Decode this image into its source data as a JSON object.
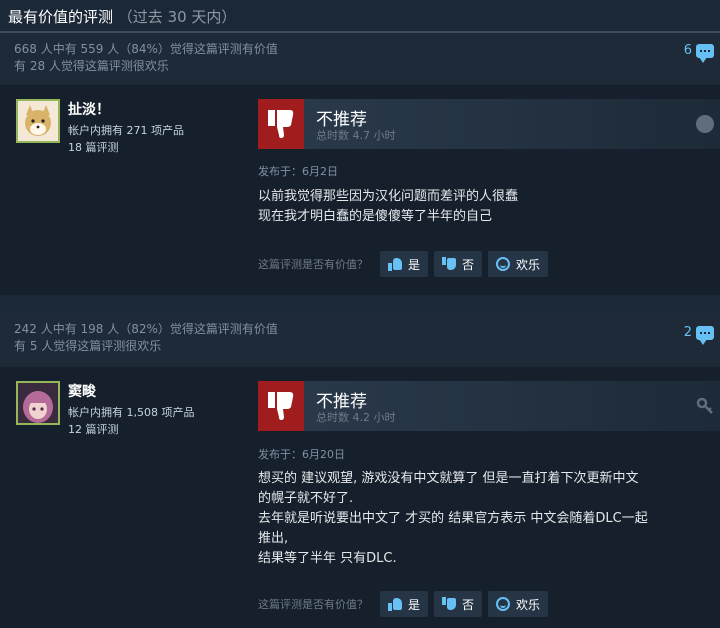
{
  "section": {
    "title": "最有价值的评测",
    "subtitle": "（过去 30 天内）"
  },
  "feedback_labels": {
    "question": "这篇评测是否有价值？",
    "yes": "是",
    "no": "否",
    "funny": "欢乐"
  },
  "reviews": [
    {
      "helpful": "668 人中有 559 人（84%）觉得这篇评测有价值",
      "funny": "有 28 人觉得这篇评测很欢乐",
      "comment_count": "6",
      "author_name": "扯淡！",
      "products": "帐户内拥有 271 项产品",
      "review_count": "18 篇评测",
      "verdict": "不推荐",
      "hours": "总时数 4.7 小时",
      "posted": "发布于：6月2日",
      "body": [
        "以前我觉得那些因为汉化问题而差评的人很蠢",
        "现在我才明白蠢的是傻傻等了半年的自己"
      ],
      "platform_icon": "steam-icon",
      "avatar_color": "#d9b36a"
    },
    {
      "helpful": "242 人中有 198 人（82%）觉得这篇评测有价值",
      "funny": "有 5 人觉得这篇评测很欢乐",
      "comment_count": "2",
      "author_name": "窦畯",
      "products": "帐户内拥有 1,508 项产品",
      "review_count": "12 篇评测",
      "verdict": "不推荐",
      "hours": "总时数 4.2 小时",
      "posted": "发布于：6月20日",
      "body": [
        "想买的 建议观望, 游戏没有中文就算了 但是一直打着下次更新中文",
        "的幌子就不好了.",
        "去年就是听说要出中文了 才买的 结果官方表示 中文会随着DLC一起",
        "推出,",
        "结果等了半年 只有DLC."
      ],
      "platform_icon": "key-icon",
      "avatar_color": "#b56b9a"
    }
  ],
  "colors": {
    "background": "#1b2838",
    "accent": "#66c0f4",
    "thumb_down": "#a11c1c"
  }
}
